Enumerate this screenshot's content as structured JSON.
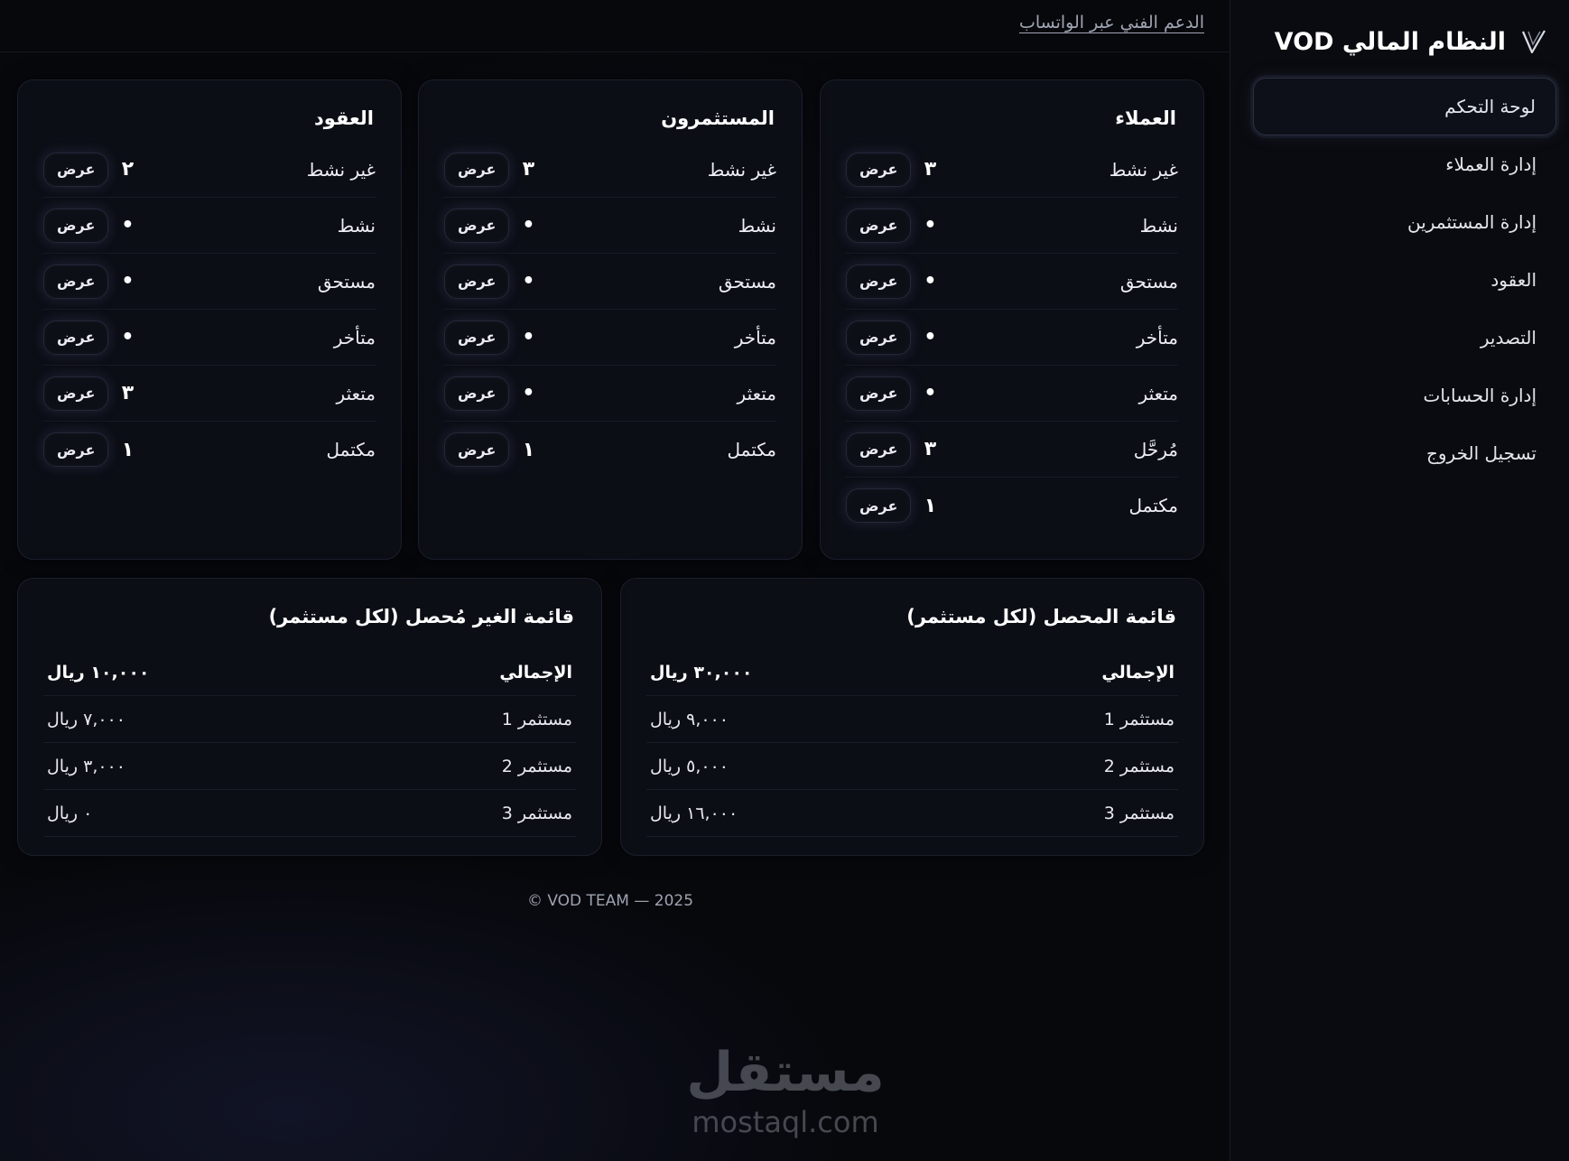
{
  "sidebar": {
    "brand_title": "النظام المالي VOD",
    "items": [
      {
        "label": "لوحة التحكم",
        "active": true
      },
      {
        "label": "إدارة العملاء"
      },
      {
        "label": "إدارة المستثمرين"
      },
      {
        "label": "العقود"
      },
      {
        "label": "التصدير"
      },
      {
        "label": "إدارة الحسابات"
      },
      {
        "label": "تسجيل الخروج"
      }
    ]
  },
  "header": {
    "support_link": "الدعم الفني عبر الواتساب"
  },
  "view_label": "عرض",
  "status_cards": [
    {
      "title": "العملاء",
      "rows": [
        {
          "label": "غير نشط",
          "count": "٣"
        },
        {
          "label": "نشط",
          "count": "•"
        },
        {
          "label": "مستحق",
          "count": "•"
        },
        {
          "label": "متأخر",
          "count": "•"
        },
        {
          "label": "متعثر",
          "count": "•"
        },
        {
          "label": "مُرحَّل",
          "count": "٣"
        },
        {
          "label": "مكتمل",
          "count": "١"
        }
      ]
    },
    {
      "title": "المستثمرون",
      "rows": [
        {
          "label": "غير نشط",
          "count": "٣"
        },
        {
          "label": "نشط",
          "count": "•"
        },
        {
          "label": "مستحق",
          "count": "•"
        },
        {
          "label": "متأخر",
          "count": "•"
        },
        {
          "label": "متعثر",
          "count": "•"
        },
        {
          "label": "مكتمل",
          "count": "١"
        }
      ]
    },
    {
      "title": "العقود",
      "rows": [
        {
          "label": "غير نشط",
          "count": "٢"
        },
        {
          "label": "نشط",
          "count": "•"
        },
        {
          "label": "مستحق",
          "count": "•"
        },
        {
          "label": "متأخر",
          "count": "•"
        },
        {
          "label": "متعثر",
          "count": "٣"
        },
        {
          "label": "مكتمل",
          "count": "١"
        }
      ]
    }
  ],
  "summaries": [
    {
      "title": "قائمة المحصل (لكل مستثمر)",
      "total_label": "الإجمالي",
      "total_value": "٣٠,٠٠٠ ريال",
      "rows": [
        {
          "name": "مستثمر 1",
          "value": "٩,٠٠٠ ريال"
        },
        {
          "name": "مستثمر 2",
          "value": "٥,٠٠٠ ريال"
        },
        {
          "name": "مستثمر 3",
          "value": "١٦,٠٠٠ ريال"
        }
      ]
    },
    {
      "title": "قائمة الغير مُحصل (لكل مستثمر)",
      "total_label": "الإجمالي",
      "total_value": "١٠,٠٠٠ ريال",
      "rows": [
        {
          "name": "مستثمر 1",
          "value": "٧,٠٠٠ ريال"
        },
        {
          "name": "مستثمر 2",
          "value": "٣,٠٠٠ ريال"
        },
        {
          "name": "مستثمر 3",
          "value": "٠ ريال"
        }
      ]
    }
  ],
  "footer": {
    "text": "VOD TEAM — 2025 ©"
  },
  "watermark": {
    "arabic": "مستقل",
    "latin": "mostaql.com"
  },
  "icons": {
    "brand": "v-logo-icon"
  },
  "colors": {
    "background": "#07080c",
    "card": "#0c0e16",
    "text": "#ffffff",
    "muted": "#9ea3af"
  }
}
